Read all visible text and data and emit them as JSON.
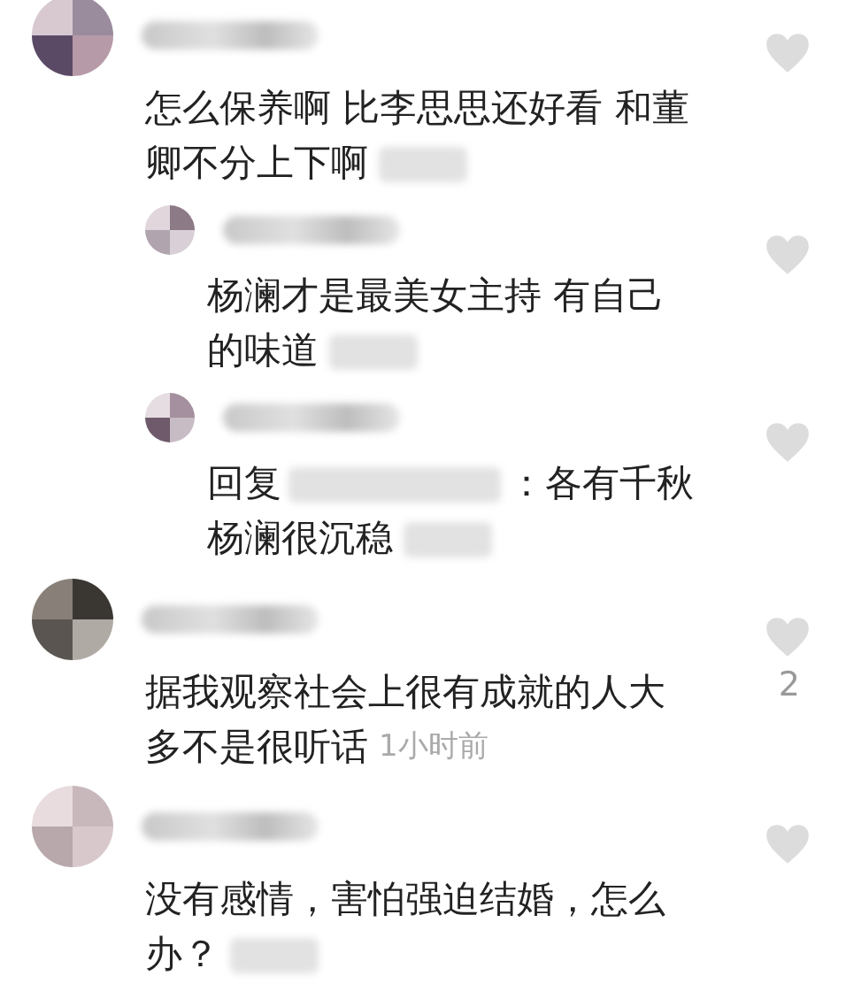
{
  "comments": [
    {
      "kind": "comment",
      "lines": [
        "怎么保养啊 比李思思还好看 和董",
        "卿不分上下啊"
      ]
    },
    {
      "kind": "reply",
      "lines": [
        "杨澜才是最美女主持 有自己",
        "的味道"
      ]
    },
    {
      "kind": "reply",
      "reply_prefix": "回复",
      "lines": [
        "：各有千秋",
        "杨澜很沉稳"
      ]
    },
    {
      "kind": "comment",
      "lines": [
        "据我观察社会上很有成就的人大",
        "多不是很听话"
      ],
      "time": "1小时前",
      "likes": "2"
    },
    {
      "kind": "comment",
      "lines": [
        "没有感情，害怕强迫结婚，怎么",
        "办？"
      ]
    }
  ]
}
